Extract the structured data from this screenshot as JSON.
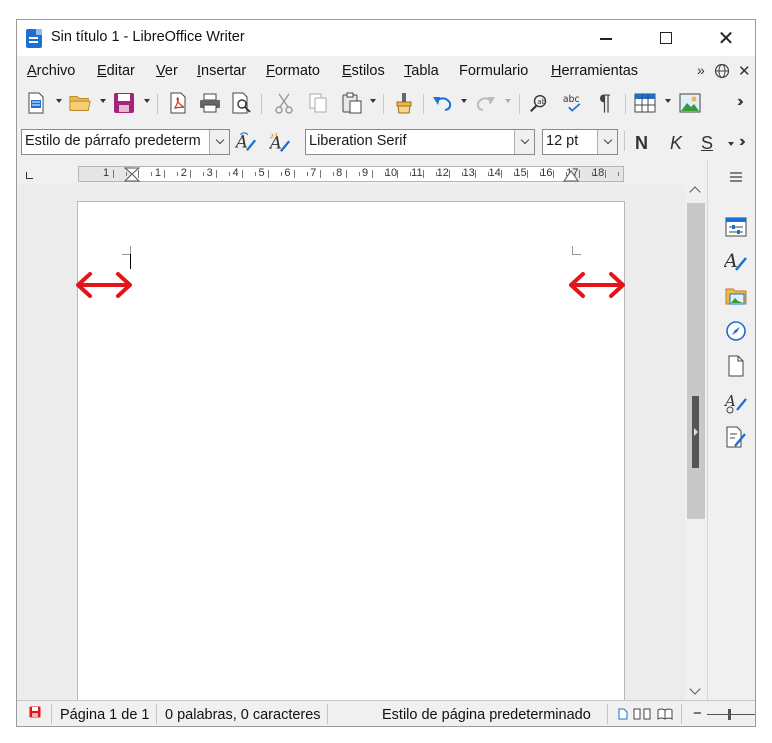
{
  "window": {
    "title": "Sin título 1 - LibreOffice Writer"
  },
  "menubar": {
    "items": [
      {
        "access": "A",
        "rest": "rchivo"
      },
      {
        "access": "E",
        "rest": "ditar"
      },
      {
        "access": "V",
        "rest": "er"
      },
      {
        "access": "I",
        "rest": "nsertar"
      },
      {
        "access": "F",
        "rest": "ormato"
      },
      {
        "access": "E",
        "rest": "stilos"
      },
      {
        "access": "T",
        "rest": "abla"
      },
      {
        "access": "",
        "rest": "Formulario"
      },
      {
        "access": "H",
        "rest": "erramientas"
      }
    ],
    "overflow": "»"
  },
  "formatting": {
    "paragraph_style": "Estilo de párrafo predeterm",
    "font_name": "Liberation Serif",
    "font_size": "12 pt",
    "bold_letter": "N",
    "italic_letter": "K",
    "shadow_letter": "S"
  },
  "ruler": {
    "labels": [
      "1",
      "1",
      "1",
      "2",
      "3",
      "4",
      "5",
      "6",
      "7",
      "8",
      "9",
      "10",
      "11",
      "12",
      "13",
      "14",
      "15",
      "16",
      "17",
      "18"
    ]
  },
  "statusbar": {
    "page": "Página 1 de 1",
    "words": "0 palabras, 0 caracteres",
    "page_style": "Estilo de página predeterminado"
  },
  "colors": {
    "accent_blue": "#1d6fd1",
    "save_magenta": "#a3247a",
    "annotation_red": "#e3151b",
    "folder_yellow": "#f0b84a"
  },
  "icons": [
    "new-document-icon",
    "open-folder-icon",
    "save-icon",
    "export-pdf-icon",
    "print-icon",
    "print-preview-icon",
    "cut-icon",
    "copy-icon",
    "paste-icon",
    "clone-formatting-icon",
    "undo-icon",
    "redo-icon",
    "find-replace-icon",
    "spelling-icon",
    "formatting-marks-icon",
    "insert-table-icon",
    "insert-image-icon"
  ]
}
